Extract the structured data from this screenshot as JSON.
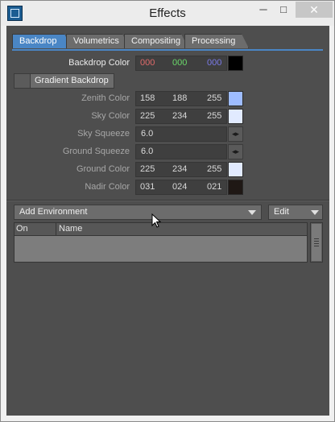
{
  "window": {
    "title": "Effects",
    "minimize_glyph": "─",
    "maximize_glyph": "□",
    "close_glyph": "✕"
  },
  "tabs": [
    "Backdrop",
    "Volumetrics",
    "Compositing",
    "Processing"
  ],
  "active_tab": "Backdrop",
  "backdrop_color": {
    "label": "Backdrop Color",
    "r": "000",
    "g": "000",
    "b": "000",
    "r_color": "#e06a6a",
    "g_color": "#6ad86a",
    "b_color": "#7a7ae8",
    "swatch": "#000000"
  },
  "gradient_backdrop": {
    "label": "Gradient Backdrop",
    "checked": false
  },
  "zenith_color": {
    "label": "Zenith Color",
    "r": "158",
    "g": "188",
    "b": "255",
    "swatch": "#9ebcff"
  },
  "sky_color": {
    "label": "Sky Color",
    "r": "225",
    "g": "234",
    "b": "255",
    "swatch": "#e1eaff"
  },
  "sky_squeeze": {
    "label": "Sky Squeeze",
    "value": "6.0"
  },
  "ground_squeeze": {
    "label": "Ground Squeeze",
    "value": "6.0"
  },
  "ground_color": {
    "label": "Ground Color",
    "r": "225",
    "g": "234",
    "b": "255",
    "swatch": "#e1eaff"
  },
  "nadir_color": {
    "label": "Nadir Color",
    "r": "031",
    "g": "024",
    "b": "021",
    "swatch": "#1f1815"
  },
  "spinner_glyph": "◂▸",
  "add_environment": {
    "label": "Add Environment"
  },
  "edit_menu": {
    "label": "Edit"
  },
  "environment_list": {
    "columns": [
      "On",
      "Name"
    ],
    "rows": []
  },
  "colors": {
    "panel": "#4e4e4e",
    "tab_active": "#4a86c5",
    "button": "#6c6c6c"
  }
}
